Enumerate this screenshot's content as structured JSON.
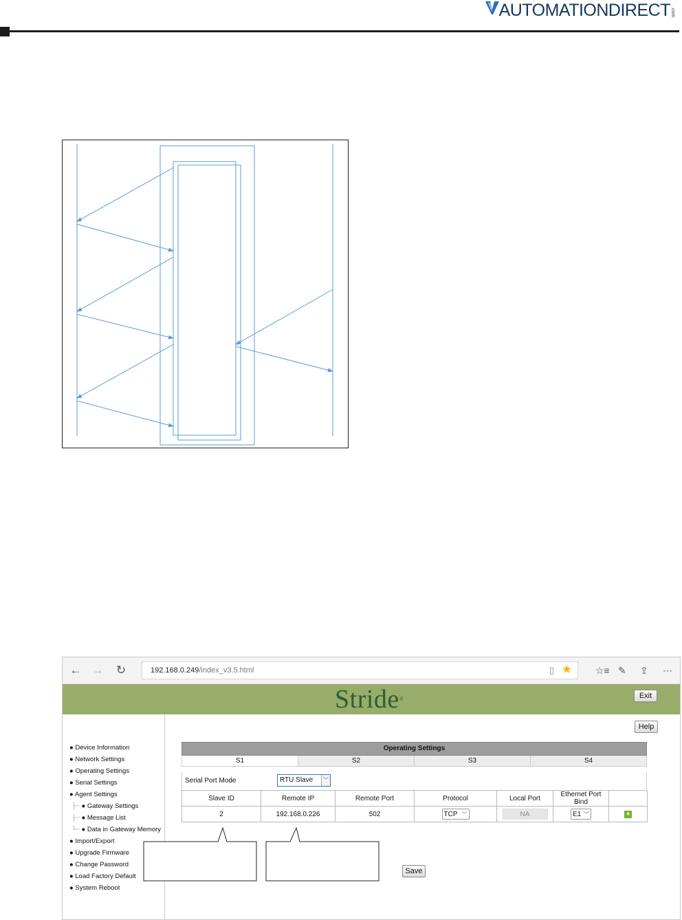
{
  "header": {
    "brand_text": "AUTOMATIONDIRECT",
    "brand_suffix": ".com"
  },
  "browser": {
    "url_host": "192.168.0.249",
    "url_path": "/index_v3.5.html",
    "nav_icons": [
      "back-icon",
      "forward-icon",
      "refresh-icon"
    ],
    "toolbar_icons": [
      "reading-view-icon",
      "favorite-star-icon",
      "favorites-list-icon",
      "pen-icon",
      "share-icon",
      "more-icon"
    ],
    "accent_star": "#f2b705"
  },
  "app": {
    "brand": "Stride",
    "brand_mark": "®",
    "banner_color": "#98ad6a",
    "exit_label": "Exit",
    "help_label": "Help",
    "save_label": "Save"
  },
  "sidebar": {
    "items": [
      {
        "label": "Device Information",
        "level": 0
      },
      {
        "label": "Network Settings",
        "level": 0
      },
      {
        "label": "Operating Settings",
        "level": 0
      },
      {
        "label": "Serial Settings",
        "level": 0
      },
      {
        "label": "Agent Settings",
        "level": 0
      },
      {
        "label": "Gateway Settings",
        "level": 1
      },
      {
        "label": "Message List",
        "level": 1
      },
      {
        "label": "Data in Gateway Memory",
        "level": 1
      },
      {
        "label": "Import/Export",
        "level": 0
      },
      {
        "label": "Upgrade Firmware",
        "level": 0
      },
      {
        "label": "Change Password",
        "level": 0
      },
      {
        "label": "Load Factory Default",
        "level": 0
      },
      {
        "label": "System Reboot",
        "level": 0
      }
    ]
  },
  "operating": {
    "title": "Operating Settings",
    "tabs": [
      "S1",
      "S2",
      "S3",
      "S4"
    ],
    "serial_port_mode_label": "Serial Port Mode",
    "serial_port_mode_value": "RTU Slave",
    "columns": [
      "Slave ID",
      "Remote IP",
      "Remote Port",
      "Protocol",
      "Local Port",
      "Ethernet Port Bind",
      ""
    ],
    "row": {
      "slave_id": "2",
      "remote_ip": "192.168.0.226",
      "remote_port": "502",
      "protocol": "TCP",
      "local_port": "NA",
      "ethernet_port_bind": "E1",
      "add_symbol": "+"
    }
  }
}
